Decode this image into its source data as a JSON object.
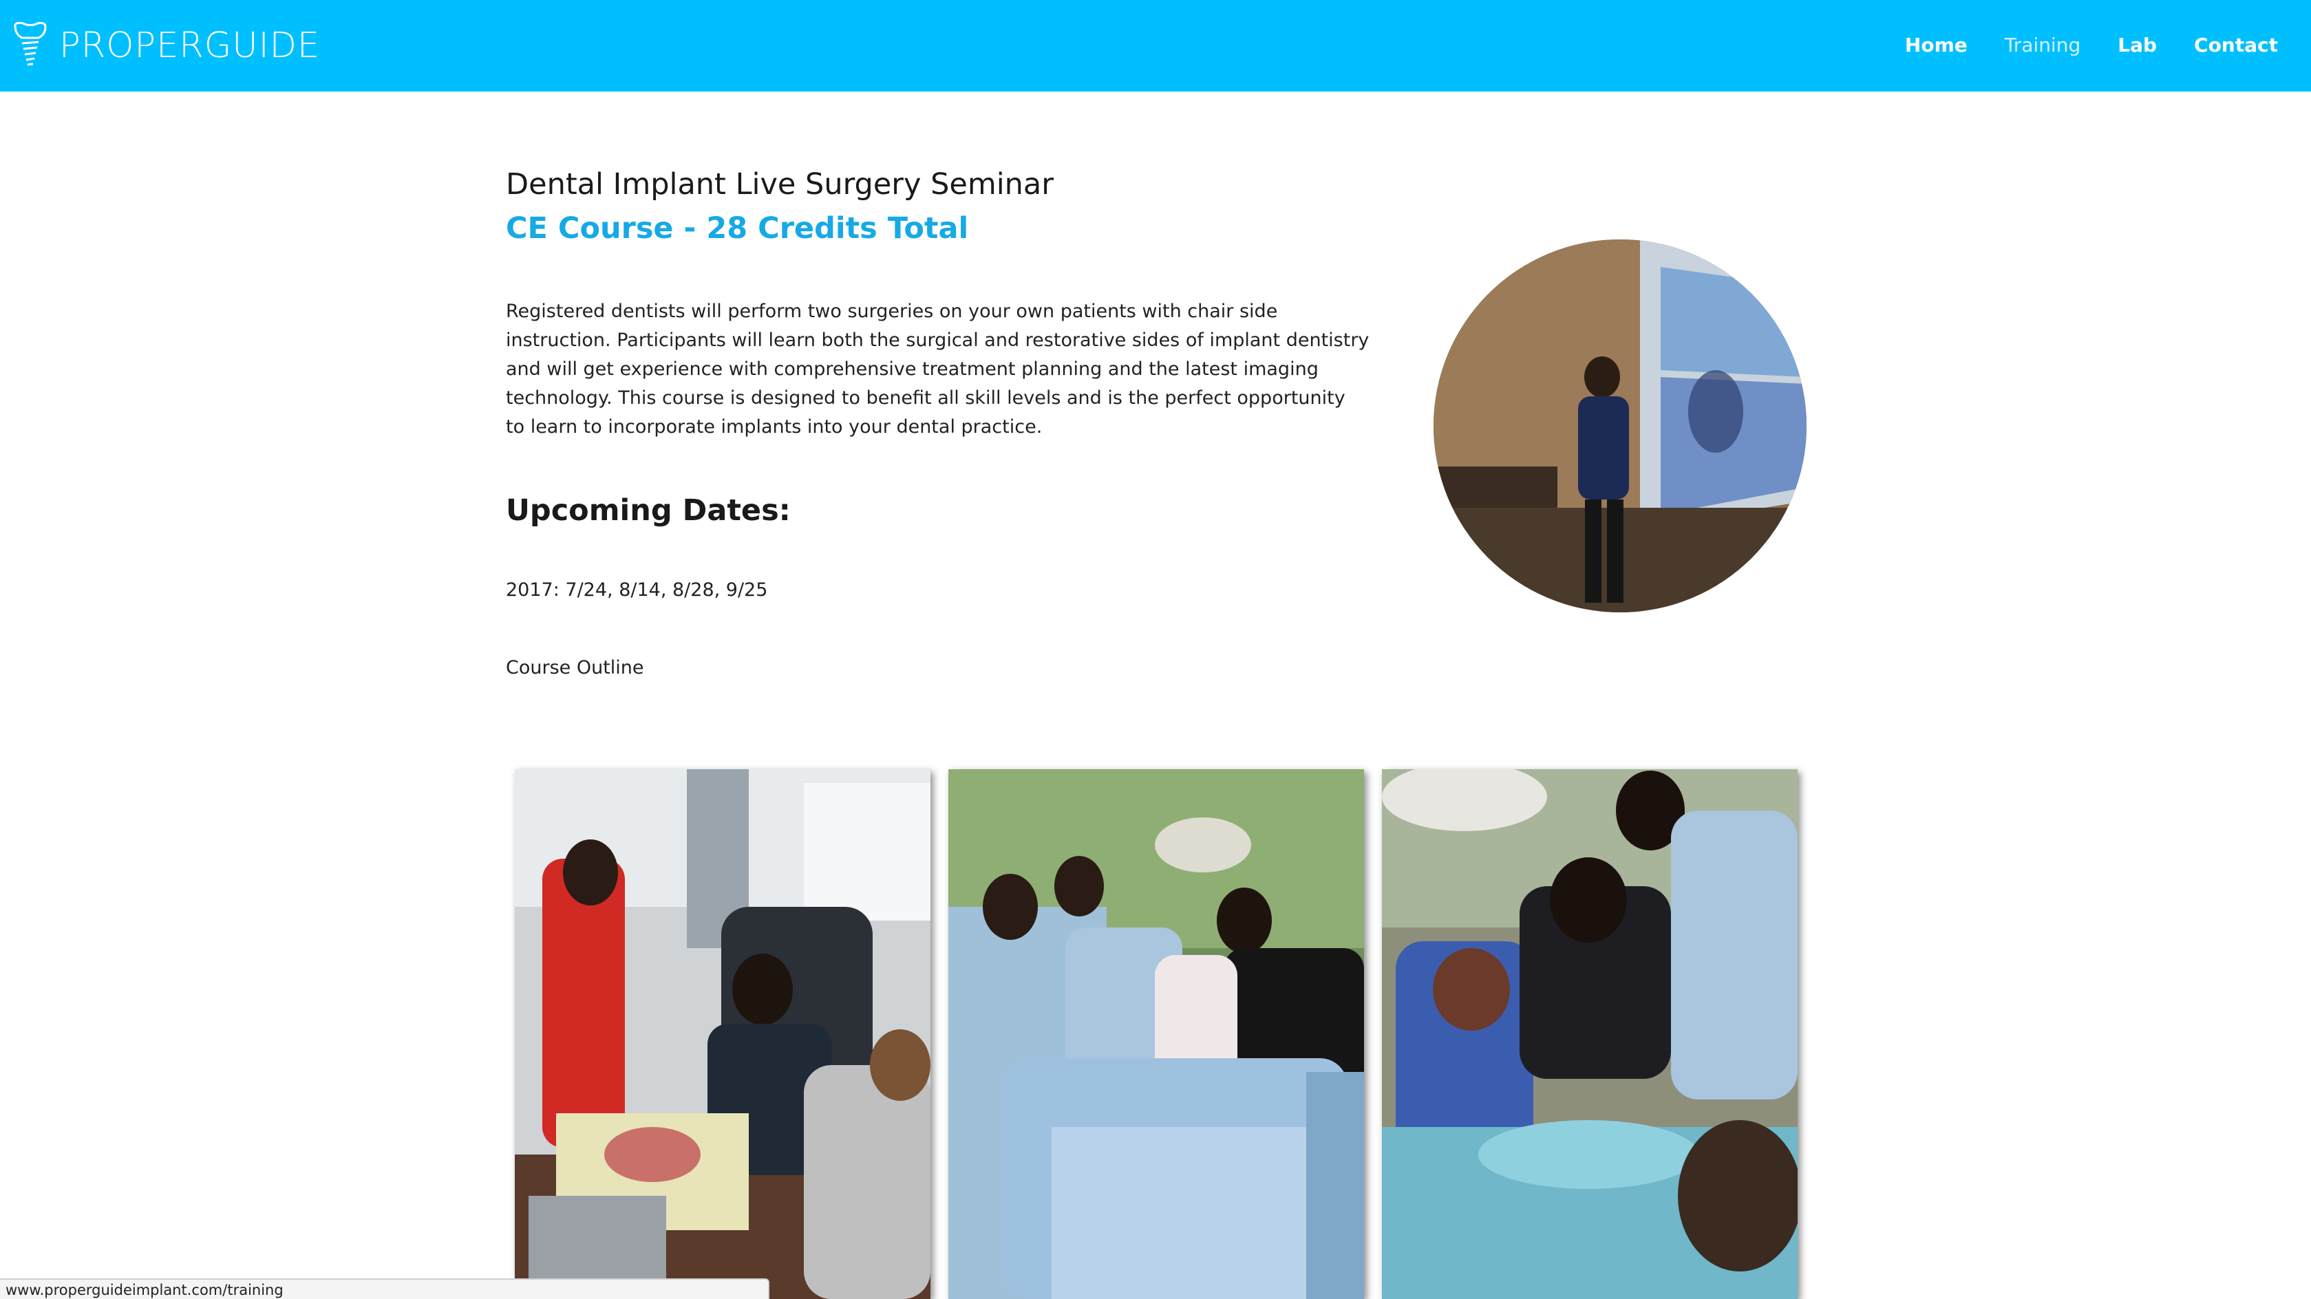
{
  "brand": {
    "name": "PROPERGUIDE",
    "logo_icon": "tooth-implant-icon"
  },
  "nav": {
    "items": [
      {
        "label": "Home",
        "active": false
      },
      {
        "label": "Training",
        "active": true
      },
      {
        "label": "Lab",
        "active": false
      },
      {
        "label": "Contact",
        "active": false
      }
    ]
  },
  "main": {
    "title": "Dental Implant Live Surgery Seminar",
    "subtitle": "CE Course - 28 Credits Total",
    "description": "Registered dentists will perform two surgeries on your own patients with chair side instruction. Participants will learn both the surgical and restorative sides of implant dentistry and will get experience with comprehensive treatment planning and the latest imaging technology. This course is designed to benefit all skill levels and is the perfect opportunity to learn to incorporate implants into your dental practice.",
    "dates_heading": "Upcoming Dates:",
    "dates": "2017: 7/24, 8/14, 8/28, 9/25",
    "outline_link": "Course Outline"
  },
  "status_bar": {
    "url": "www.properguideimplant.com/training"
  },
  "colors": {
    "header_bg": "#00bfff",
    "accent": "#16a9e6"
  }
}
